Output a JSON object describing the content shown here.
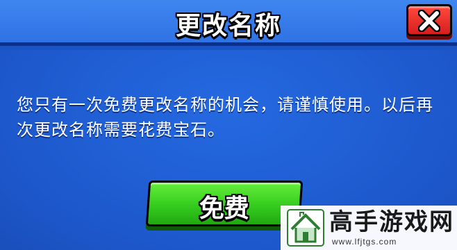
{
  "dialog": {
    "title": "更改名称",
    "message_line1": "您只有一次免费更改名称的机会，请谨慎使用。以后再",
    "message_line2": "次更改名称需要花费宝石。",
    "free_button_label": "免费",
    "close_icon": "close-x-icon"
  },
  "watermark": {
    "title": "高手游戏网",
    "url": "www.lfjtgs.com",
    "logo_icon": "house-logo-icon"
  },
  "colors": {
    "dialog_blue": "#1f5fd6",
    "header_blue": "#3f86f0",
    "close_red": "#d81e1e",
    "button_green": "#35cc1e"
  }
}
